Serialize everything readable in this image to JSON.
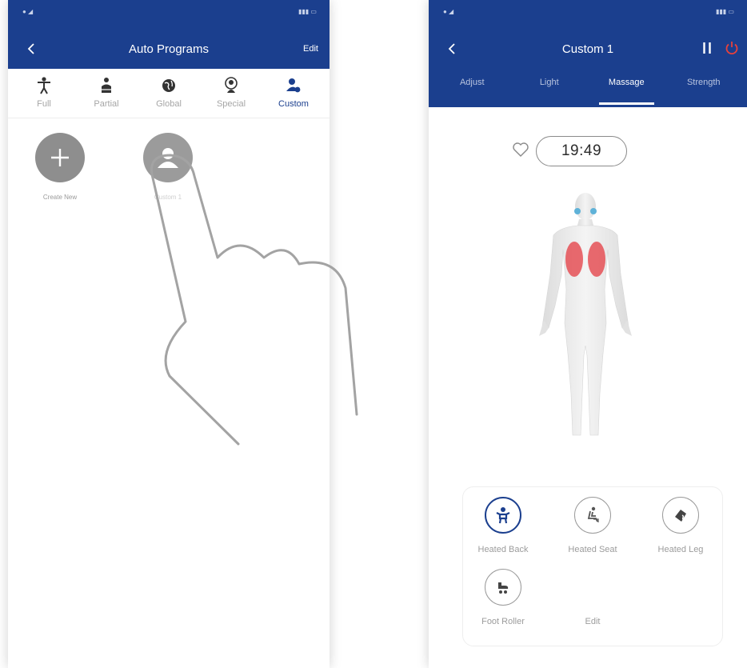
{
  "left_screen": {
    "header": {
      "title": "Auto Programs",
      "edit_label": "Edit"
    },
    "categories": [
      {
        "label": "Full",
        "icon": "person-full-icon"
      },
      {
        "label": "Partial",
        "icon": "person-partial-icon"
      },
      {
        "label": "Global",
        "icon": "globe-icon"
      },
      {
        "label": "Special",
        "icon": "special-icon"
      },
      {
        "label": "Custom",
        "icon": "custom-user-icon",
        "active": true
      }
    ],
    "programs": [
      {
        "label": "Create New",
        "icon": "plus-icon"
      },
      {
        "label": "Custom 1",
        "icon": "user-icon"
      }
    ]
  },
  "right_screen": {
    "header": {
      "title": "Custom 1"
    },
    "tabs": [
      {
        "label": "Adjust"
      },
      {
        "label": "Light"
      },
      {
        "label": "Massage",
        "active": true
      },
      {
        "label": "Strength"
      }
    ],
    "timer": "19:49",
    "functions": [
      {
        "label": "Heated Back",
        "icon": "heated-back-icon",
        "active": true
      },
      {
        "label": "Heated Seat",
        "icon": "heated-seat-icon"
      },
      {
        "label": "Heated Leg",
        "icon": "heated-leg-icon"
      },
      {
        "label": "Foot Roller",
        "icon": "foot-roller-icon"
      },
      {
        "label": "Edit"
      }
    ]
  },
  "colors": {
    "header_blue": "#1b3f8e",
    "power_red": "#e8413b",
    "heat_red": "#e5464c"
  }
}
